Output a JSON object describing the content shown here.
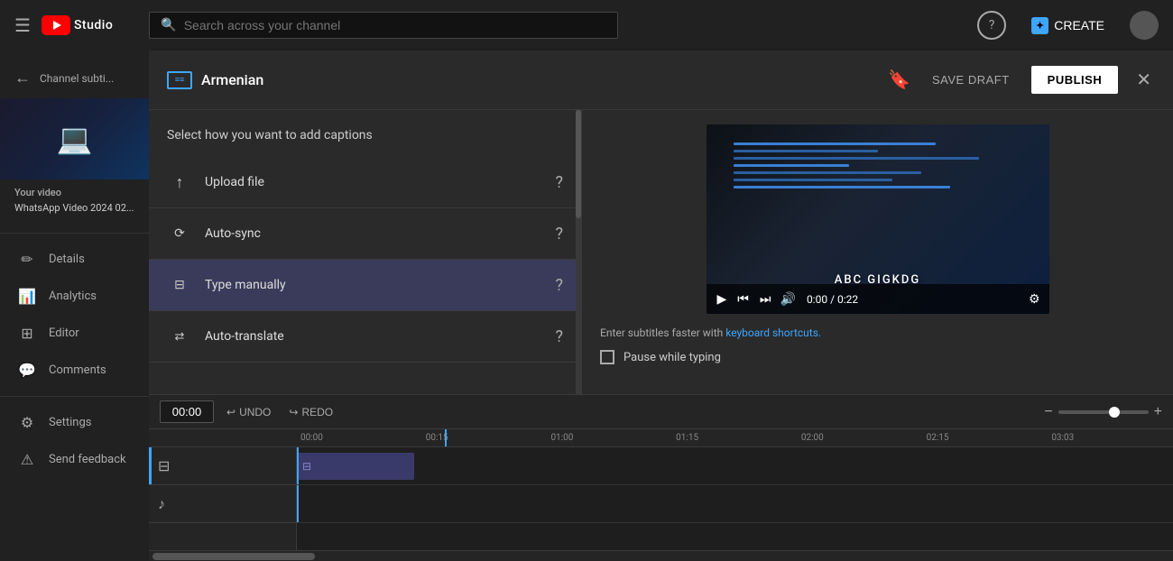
{
  "topbar": {
    "hamburger_label": "☰",
    "logo_icon": "▶",
    "studio_text": "Studio",
    "search_placeholder": "Search across your channel",
    "help_icon": "?",
    "create_label": "CREATE",
    "create_icon": "✦"
  },
  "sidebar": {
    "back_label": "Channel subti...",
    "video_label": "Your video",
    "video_title": "WhatsApp Video 2024 02...",
    "nav_items": [
      {
        "id": "details",
        "label": "Details",
        "icon": "✏"
      },
      {
        "id": "analytics",
        "label": "Analytics",
        "icon": "📊"
      },
      {
        "id": "editor",
        "label": "Editor",
        "icon": "⊞"
      },
      {
        "id": "comments",
        "label": "Comments",
        "icon": "💬"
      },
      {
        "id": "settings",
        "label": "Settings",
        "icon": "⚙"
      },
      {
        "id": "send-feedback",
        "label": "Send feedback",
        "icon": "⚠"
      }
    ]
  },
  "modal": {
    "lang_icon_text": "≡",
    "title": "Armenian",
    "save_draft_label": "SAVE DRAFT",
    "publish_label": "PUBLISH",
    "caption_panel": {
      "select_label": "Select how you want to add captions",
      "options": [
        {
          "id": "upload",
          "label": "Upload file",
          "icon": "↑"
        },
        {
          "id": "auto-sync",
          "label": "Auto-sync",
          "icon": "⟳"
        },
        {
          "id": "type-manually",
          "label": "Type manually",
          "icon": "⊟"
        },
        {
          "id": "auto-translate",
          "label": "Auto-translate",
          "icon": "⇄"
        }
      ]
    },
    "video_panel": {
      "subtitle_text": "ABC GIGKDG",
      "time_current": "0:00",
      "time_total": "0:22",
      "keyboard_hint": "Enter subtitles faster with",
      "keyboard_link_text": "keyboard shortcuts.",
      "pause_label": "Pause while typing"
    }
  },
  "timeline": {
    "time_input": "00:00",
    "undo_label": "UNDO",
    "redo_label": "REDO",
    "ruler_marks": [
      "00:00",
      "00:15",
      "01:00",
      "01:15",
      "02:00",
      "02:15",
      "03:03"
    ]
  }
}
